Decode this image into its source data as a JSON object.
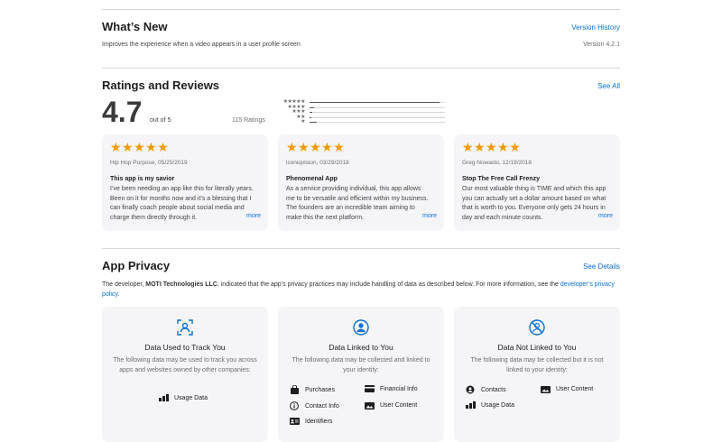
{
  "whats_new": {
    "title": "What’s New",
    "version_history": "Version History",
    "description": "Improves the experience when a video appears in a user profile screen",
    "version": "Version 4.2.1"
  },
  "ratings": {
    "title": "Ratings and Reviews",
    "see_all": "See All",
    "score": "4.7",
    "out_of": "out of 5",
    "count": "115 Ratings",
    "histogram": [
      {
        "stars": "★★★★★",
        "fraction": 0.96
      },
      {
        "stars": "★★★★",
        "fraction": 0.03
      },
      {
        "stars": "★★★",
        "fraction": 0.02
      },
      {
        "stars": "★★",
        "fraction": 0.01
      },
      {
        "stars": "★",
        "fraction": 0.05
      }
    ]
  },
  "reviews": [
    {
      "stars": "★★★★★",
      "meta": "Hip Hop Purpose, 05/25/2019",
      "title": "This app is my savior",
      "body": "I’ve been needing an app like this for literally years. Been on it for months now and it’s a blessing that I can finally coach people about social media and charge them directly through it.",
      "more": "more"
    },
    {
      "stars": "★★★★★",
      "meta": "iconiqvision, 03/29/2018",
      "title": "Phenomenal App",
      "body": "As a service providing individual, this app allows me to be versatile and efficient within my business. The founders are an incredible team aiming to make this the next platform.",
      "more": "more"
    },
    {
      "stars": "★★★★★",
      "meta": "Greg Nowacki, 12/19/2018",
      "title": "Stop The Free Call Frenzy",
      "body": "Our most valuable thing is TIME and which this app you can actually set a dollar amount based on what that is worth to you. Everyone only gets 24 hours in day and each minute counts.",
      "more": "more"
    }
  ],
  "privacy": {
    "title": "App Privacy",
    "see_details": "See Details",
    "intro_prefix": "The developer, ",
    "developer": "MOTI Technologies LLC",
    "intro_suffix": ", indicated that the app’s privacy practices may include handling of data as described below. For more information, see the ",
    "policy_link": "developer’s privacy policy",
    "intro_end": ".",
    "cards": [
      {
        "icon": "track-icon",
        "title": "Data Used to Track You",
        "desc": "The following data may be used to track you across apps and websites owned by other companies:",
        "items": [
          "Usage Data"
        ]
      },
      {
        "icon": "linked-user-icon",
        "title": "Data Linked to You",
        "desc": "The following data may be collected and linked to your identity:",
        "items": [
          "Purchases",
          "Financial Info",
          "Contact Info",
          "User Content",
          "Identifiers"
        ]
      },
      {
        "icon": "not-linked-icon",
        "title": "Data Not Linked to You",
        "desc": "The following data may be collected but it is not linked to your identity:",
        "items": [
          "Contacts",
          "User Content",
          "Usage Data"
        ]
      }
    ]
  },
  "colors": {
    "accent": "#0a6fd6",
    "star": "#f29b05",
    "card_bg": "#f5f5f7"
  }
}
